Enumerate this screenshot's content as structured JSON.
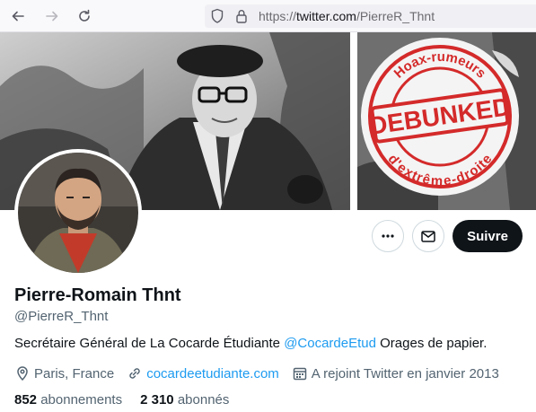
{
  "browser": {
    "url_scheme": "https://",
    "url_domain": "twitter.com",
    "url_path": "/PierreR_Thnt"
  },
  "banner": {
    "stamp_text_top": "Hoax-rumeurs",
    "stamp_text_center": "DEBUNKED",
    "stamp_text_bottom": "d'extrême-droite"
  },
  "actions": {
    "follow_label": "Suivre"
  },
  "profile": {
    "display_name": "Pierre-Romain Thnt",
    "handle": "@PierreR_Thnt",
    "bio_before": "Secrétaire Général de La Cocarde Étudiante ",
    "bio_mention": "@CocardeEtud",
    "bio_after": " Orages de papier.",
    "location": "Paris, France",
    "website": "cocardeetudiante.com",
    "joined": "A rejoint Twitter en janvier 2013",
    "following_count": "852",
    "following_label": " abonnements",
    "followers_count": "2 310",
    "followers_label": " abonnés"
  },
  "colors": {
    "accent": "#1d9bf0",
    "text_primary": "#0f1419",
    "text_secondary": "#536471",
    "stamp_red": "#d42a2a"
  }
}
